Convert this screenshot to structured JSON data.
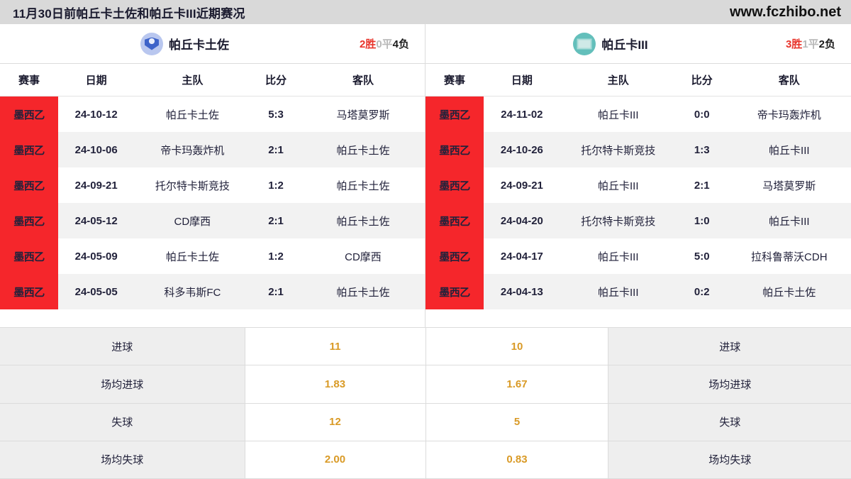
{
  "titlebar": {
    "title": "11月30日前帕丘卡土佐和帕丘卡III近期赛况",
    "site_url": "www.fczhibo.net"
  },
  "colors": {
    "league_badge_bg": "#f5262b",
    "win": "#e8342b",
    "draw": "#b9b9b9",
    "loss": "#1a1a1a",
    "stat_value": "#d99a26",
    "titlebar_bg": "#d9d9d9",
    "logo_left_bg": "#b9c7ef",
    "logo_right_bg": "#63bfbb"
  },
  "columns": {
    "league": "赛事",
    "date": "日期",
    "home": "主队",
    "score": "比分",
    "away": "客队"
  },
  "left_panel": {
    "team": {
      "name": "帕丘卡土佐",
      "logo_icon": "team-crest-icon"
    },
    "record": {
      "wins": "2胜",
      "draws": "0平",
      "losses": "4负"
    },
    "matches": [
      {
        "league": "墨西乙",
        "date": "24-10-12",
        "home": "帕丘卡土佐",
        "score": "5:3",
        "away": "马塔莫罗斯"
      },
      {
        "league": "墨西乙",
        "date": "24-10-06",
        "home": "帝卡玛轰炸机",
        "score": "2:1",
        "away": "帕丘卡土佐"
      },
      {
        "league": "墨西乙",
        "date": "24-09-21",
        "home": "托尔特卡斯竞技",
        "score": "1:2",
        "away": "帕丘卡土佐"
      },
      {
        "league": "墨西乙",
        "date": "24-05-12",
        "home": "CD摩西",
        "score": "2:1",
        "away": "帕丘卡土佐"
      },
      {
        "league": "墨西乙",
        "date": "24-05-09",
        "home": "帕丘卡土佐",
        "score": "1:2",
        "away": "CD摩西"
      },
      {
        "league": "墨西乙",
        "date": "24-05-05",
        "home": "科多韦斯FC",
        "score": "2:1",
        "away": "帕丘卡土佐"
      }
    ],
    "stats": [
      {
        "label": "进球",
        "value": "11"
      },
      {
        "label": "场均进球",
        "value": "1.83"
      },
      {
        "label": "失球",
        "value": "12"
      },
      {
        "label": "场均失球",
        "value": "2.00"
      }
    ]
  },
  "right_panel": {
    "team": {
      "name": "帕丘卡III",
      "logo_icon": "team-goal-icon"
    },
    "record": {
      "wins": "3胜",
      "draws": "1平",
      "losses": "2负"
    },
    "matches": [
      {
        "league": "墨西乙",
        "date": "24-11-02",
        "home": "帕丘卡III",
        "score": "0:0",
        "away": "帝卡玛轰炸机"
      },
      {
        "league": "墨西乙",
        "date": "24-10-26",
        "home": "托尔特卡斯竞技",
        "score": "1:3",
        "away": "帕丘卡III"
      },
      {
        "league": "墨西乙",
        "date": "24-09-21",
        "home": "帕丘卡III",
        "score": "2:1",
        "away": "马塔莫罗斯"
      },
      {
        "league": "墨西乙",
        "date": "24-04-20",
        "home": "托尔特卡斯竞技",
        "score": "1:0",
        "away": "帕丘卡III"
      },
      {
        "league": "墨西乙",
        "date": "24-04-17",
        "home": "帕丘卡III",
        "score": "5:0",
        "away": "拉科鲁蒂沃CDH"
      },
      {
        "league": "墨西乙",
        "date": "24-04-13",
        "home": "帕丘卡III",
        "score": "0:2",
        "away": "帕丘卡土佐"
      }
    ],
    "stats": [
      {
        "label": "进球",
        "value": "10"
      },
      {
        "label": "场均进球",
        "value": "1.67"
      },
      {
        "label": "失球",
        "value": "5"
      },
      {
        "label": "场均失球",
        "value": "0.83"
      }
    ]
  }
}
